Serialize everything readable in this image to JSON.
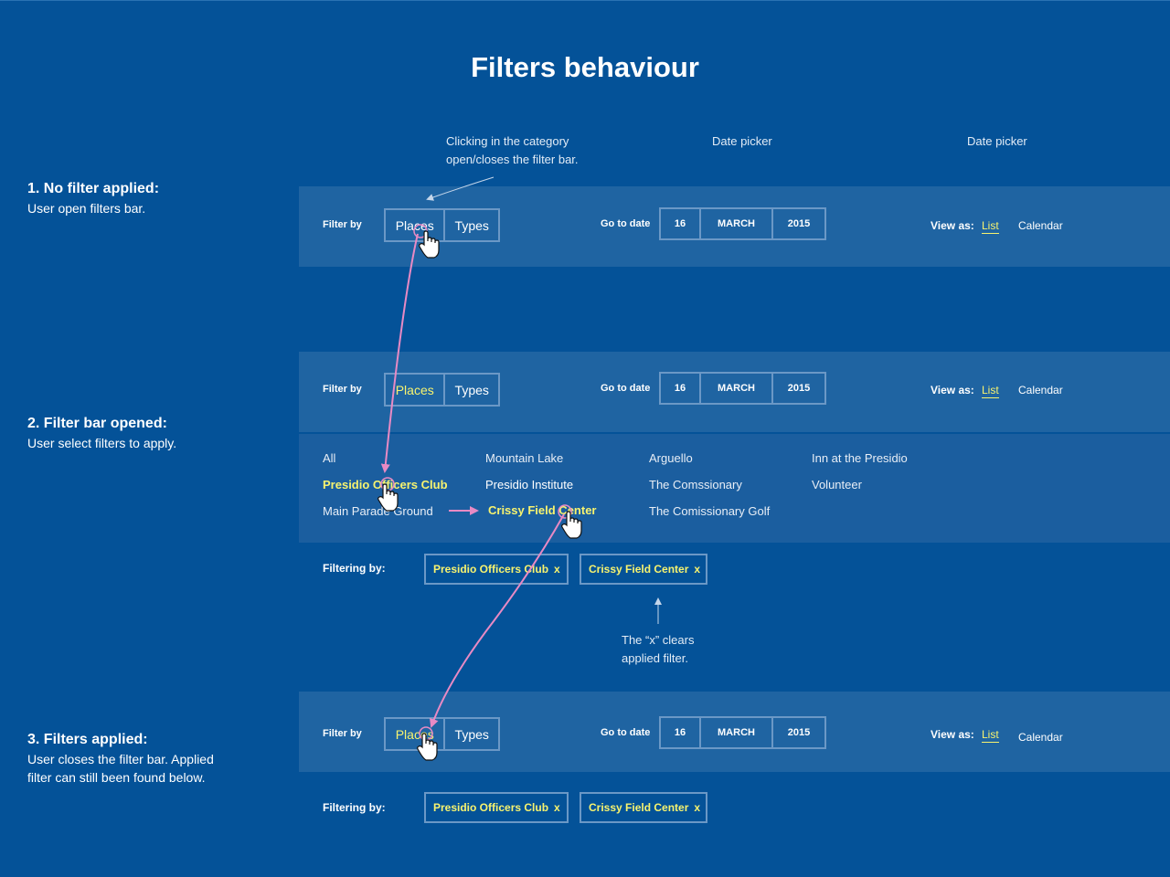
{
  "page": {
    "title": "Filters behaviour"
  },
  "annotations": {
    "category_click_line1": "Clicking in the category",
    "category_click_line2": "open/closes the filter bar.",
    "date_picker_1": "Date picker",
    "date_picker_2": "Date picker",
    "x_clears_line1": "The “x” clears",
    "x_clears_line2": "applied filter."
  },
  "steps": [
    {
      "title": "1. No filter applied:",
      "desc": "User open filters bar."
    },
    {
      "title": "2. Filter bar opened:",
      "desc": "User select filters to apply."
    },
    {
      "title": "3. Filters applied:",
      "desc_line1": "User closes the filter bar. Applied",
      "desc_line2": "filter can still been found below."
    }
  ],
  "filter_bar": {
    "filter_by_label": "Filter by",
    "places_label": "Places",
    "types_label": "Types",
    "go_to_date_label": "Go to date",
    "day": "16",
    "month": "MARCH",
    "year": "2015",
    "view_as_label": "View as:",
    "view_list": "List",
    "view_calendar": "Calendar"
  },
  "places_list": {
    "col1": [
      "All",
      "Presidio Officers Club",
      "Main Parade Ground"
    ],
    "col2": [
      "Mountain Lake",
      "Presidio Institute",
      "Crissy Field Center"
    ],
    "col3": [
      "Arguello",
      "The Comssionary",
      "The Comissionary Golf"
    ],
    "col4": [
      "Inn at the Presidio",
      "Volunteer"
    ]
  },
  "filtering": {
    "label": "Filtering by:",
    "chip1": "Presidio Officers Club",
    "chip2": "Crissy Field Center",
    "remove": "x"
  },
  "colors": {
    "background": "#045298",
    "bar": "#1f64a2",
    "border": "#6b98c6",
    "highlight": "#f7f36f",
    "arrow": "#e88ac4"
  }
}
